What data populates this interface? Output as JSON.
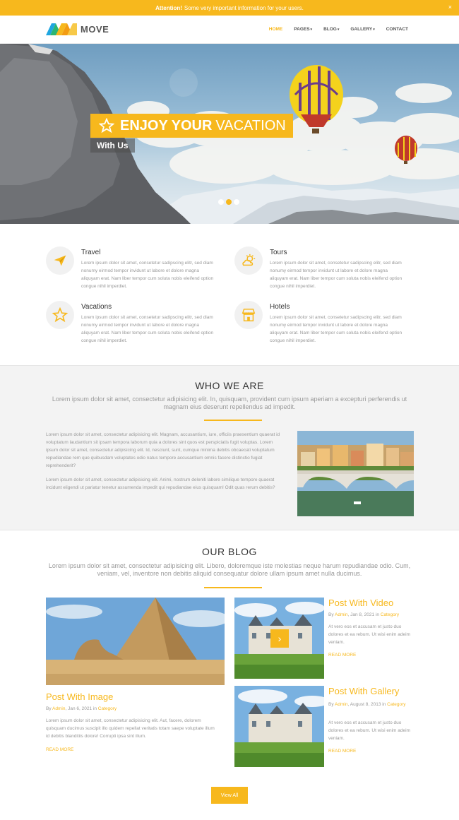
{
  "alert": {
    "strong": "Attention!",
    "text": "Some very important information for your users.",
    "close": "×"
  },
  "header": {
    "logo_text": "MOVE",
    "nav": [
      {
        "label": "HOME",
        "active": true,
        "caret": ""
      },
      {
        "label": "PAGES",
        "active": false,
        "caret": "▾"
      },
      {
        "label": "BLOG",
        "active": false,
        "caret": "▾"
      },
      {
        "label": "GALLERY",
        "active": false,
        "caret": "▾"
      },
      {
        "label": "CONTACT",
        "active": false,
        "caret": ""
      }
    ]
  },
  "hero": {
    "title_bold": "ENJOY YOUR",
    "title_light": "VACATION",
    "subtitle": "With Us",
    "slides_total": 3,
    "active_slide": 2
  },
  "services": [
    {
      "title": "Travel",
      "icon": "paper-plane-icon",
      "text": "Lorem ipsum dolor sit amet, consetetur sadipscing elitr, sed diam nonumy eirmod tempor invidunt ut labore et dolore magna aliquyam erat. Nam liber tempor cum soluta nobis eleifend option congue nihil imperdiet."
    },
    {
      "title": "Tours",
      "icon": "sun-cloud-icon",
      "text": "Lorem ipsum dolor sit amet, consetetur sadipscing elitr, sed diam nonumy eirmod tempor invidunt ut labore et dolore magna aliquyam erat. Nam liber tempor cum soluta nobis eleifend option congue nihil imperdiet."
    },
    {
      "title": "Vacations",
      "icon": "star-icon",
      "text": "Lorem ipsum dolor sit amet, consetetur sadipscing elitr, sed diam nonumy eirmod tempor invidunt ut labore et dolore magna aliquyam erat. Nam liber tempor cum soluta nobis eleifend option congue nihil imperdiet."
    },
    {
      "title": "Hotels",
      "icon": "shop-icon",
      "text": "Lorem ipsum dolor sit amet, consetetur sadipscing elitr, sed diam nonumy eirmod tempor invidunt ut labore et dolore magna aliquyam erat. Nam liber tempor cum soluta nobis eleifend option congue nihil imperdiet."
    }
  ],
  "who": {
    "title": "WHO WE ARE",
    "lead": "Lorem ipsum dolor sit amet, consectetur adipisicing elit. In, quisquam, provident cum ipsum aperiam a excepturi perferendis ut magnam eius deserunt repellendus ad impedit.",
    "p1": "Lorem ipsum dolor sit amet, consectetur adipisicing elit. Magnam, accusantium, iure, officiis praesentium quaerat id voluptatum laudantium sit ipsam tempora laborum quia a dolores sint quos est perspiciatis fugit voluptas. Lorem ipsum dolor sit amet, consectetur adipisicing elit. Id, nesciunt, sunt, cumque minima debitis obcaecati voluptatum repudiandae rem quo quibusdam voluptates odio natus tempore accusantium omnis facere distinctio fugiat reprehenderit?",
    "p2": "Lorem ipsum dolor sit amet, consectetur adipisicing elit. Animi, nostrum deleniti labore similique tempore quaerat incidunt eligendi ut pariatur tenetur assumenda impedit qui repudiandae eius quisquam! Odit quas rerum debitis?"
  },
  "blog": {
    "title": "OUR BLOG",
    "lead": "Lorem ipsum dolor sit amet, consectetur adipisicing elit. Libero, doloremque iste molestias neque harum repudiandae odio. Cum, veniam, vel, inventore non debitis aliquid consequatur dolore ullam ipsum amet nulla ducimus.",
    "posts": [
      {
        "title": "Post With Image",
        "by": "By",
        "author": "Admin",
        "date": ", Jan 6, 2021 in",
        "category": "Category",
        "text": "Lorem ipsum dolor sit amet, consectetur adipisicing elit. Aut, facere, dolorem quisquam ducimus suscipit illo quidem repellat veritatis totam saepe voluptate illum id debitis blanditiis dolore! Corrupti ipsa sint illum.",
        "read_more": "READ MORE"
      },
      {
        "title": "Post With Video",
        "by": "By",
        "author": "Admin",
        "date": ", Jan 8, 2021 in",
        "category": "Category",
        "text": "At vero eos et accusam et justo duo dolores et ea rebum. Ut wisi enim adeim veniam.",
        "read_more": "READ MORE"
      },
      {
        "title": "Post With Gallery",
        "by": "By",
        "author": "Admin",
        "date": ", August 8, 2013 in",
        "category": "Category",
        "text": "At vero eos et accusam et justo duo dolores et ea rebum. Ut wisi enim adeim veniam.",
        "read_more": "READ MORE"
      }
    ],
    "play": "›",
    "view_all": "View All"
  },
  "colors": {
    "accent": "#f7b81d",
    "text": "#999999",
    "heading": "#333333",
    "band": "#f3f3f3"
  }
}
